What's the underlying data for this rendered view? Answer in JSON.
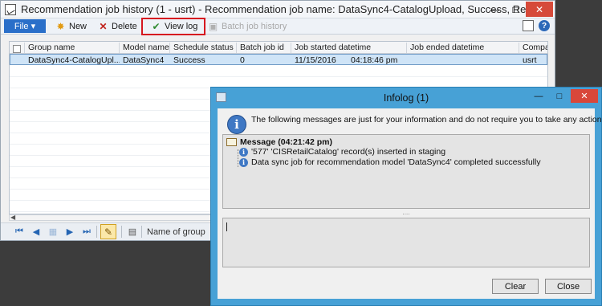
{
  "main_window": {
    "title": "Recommendation job history (1 - usrt) - Recommendation job name: DataSync4-CatalogUpload, Success, Rec...",
    "min_glyph": "—",
    "max_glyph": "□",
    "close_glyph": "✕"
  },
  "ribbon": {
    "file_label": "File",
    "file_caret": "▾",
    "new_label": "New",
    "delete_label": "Delete",
    "view_log_label": "View log",
    "batch_job_history_label": "Batch job history",
    "help_glyph": "?"
  },
  "grid": {
    "columns": [
      "Group name",
      "Model name",
      "Schedule status",
      "Batch job id",
      "Job started datetime",
      "Job ended datetime",
      "Compa"
    ],
    "rows": [
      {
        "group_name": "DataSync4-CatalogUpl...",
        "model_name": "DataSync4",
        "schedule_status": "Success",
        "batch_job_id": "0",
        "job_started_date": "11/15/2016",
        "job_started_time": "04:18:46 pm",
        "job_ended_datetime": "",
        "company": "usrt"
      }
    ]
  },
  "navbar": {
    "name_of_group_label": "Name of group"
  },
  "infolog": {
    "title": "Infolog (1)",
    "intro": "The following messages are just for your information and do not require you to take any action.",
    "message_header": "Message (04:21:42 pm)",
    "messages": [
      "'577' 'CISRetailCatalog' record(s) inserted in staging",
      "Data sync job for recommendation model 'DataSync4' completed successfully"
    ],
    "splitter_glyph": "....",
    "clear_label": "Clear",
    "close_label": "Close",
    "min_glyph": "—",
    "max_glyph": "□",
    "close_glyph": "✕"
  }
}
